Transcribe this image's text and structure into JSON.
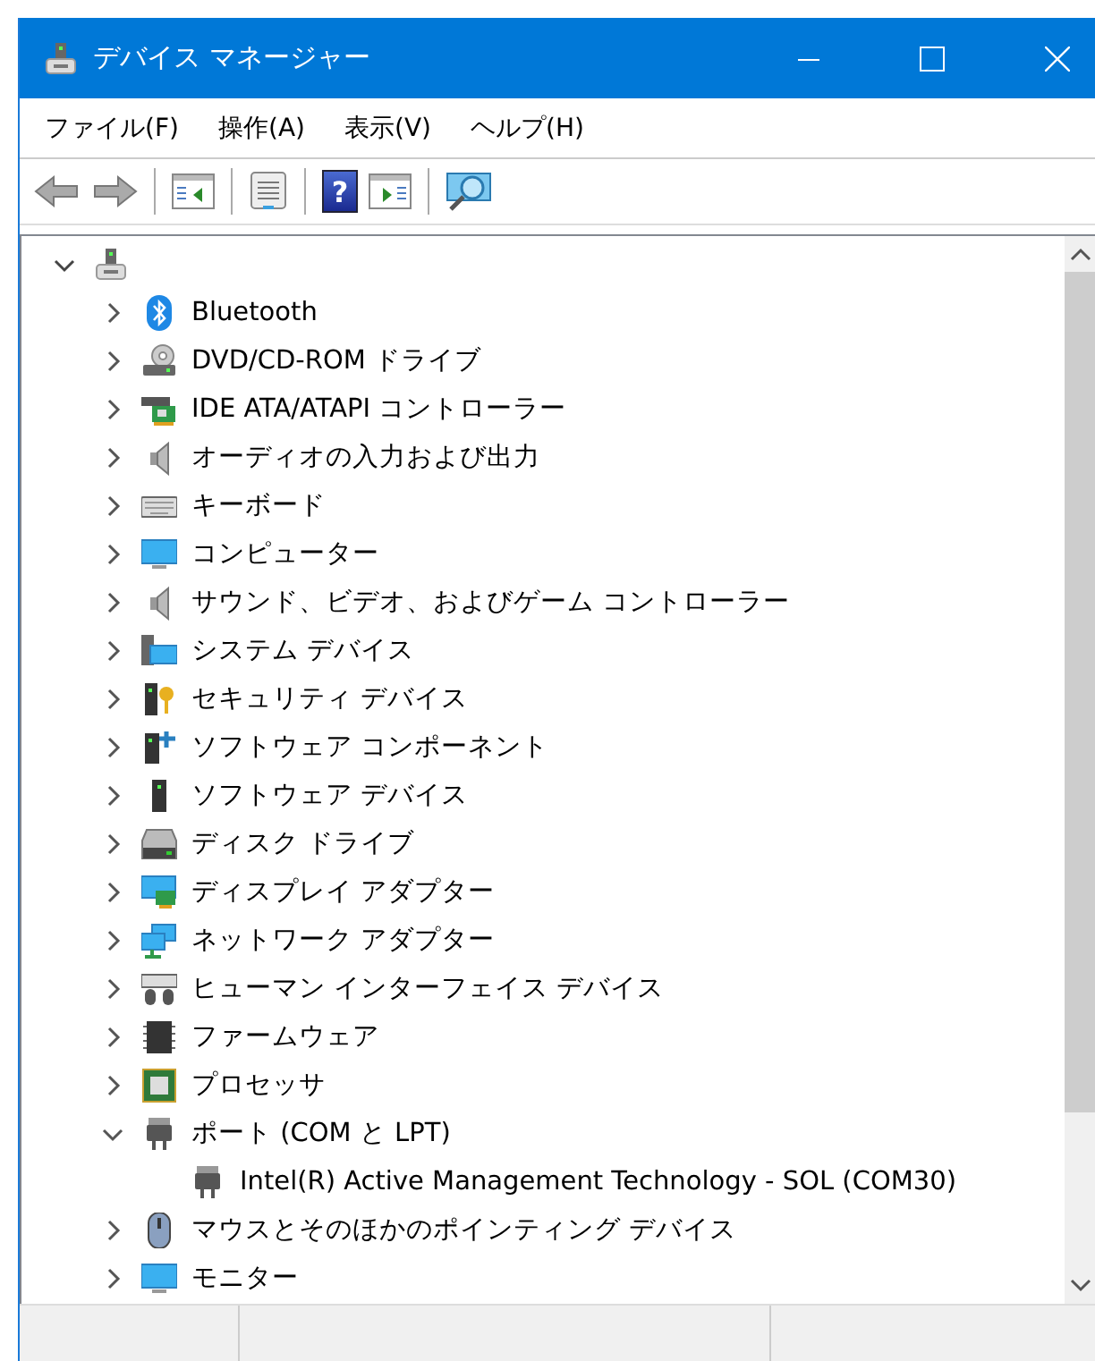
{
  "window": {
    "title": "デバイス マネージャー"
  },
  "menu": [
    "ファイル(F)",
    "操作(A)",
    "表示(V)",
    "ヘルプ(H)"
  ],
  "toolbar": {
    "help_glyph": "?"
  },
  "tree": {
    "expanded": true,
    "children": [
      {
        "label": "Bluetooth",
        "expanded": false
      },
      {
        "label": "DVD/CD-ROM ドライブ",
        "expanded": false
      },
      {
        "label": "IDE ATA/ATAPI コントローラー",
        "expanded": false
      },
      {
        "label": "オーディオの入力および出力",
        "expanded": false
      },
      {
        "label": "キーボード",
        "expanded": false
      },
      {
        "label": "コンピューター",
        "expanded": false
      },
      {
        "label": "サウンド、ビデオ、およびゲーム コントローラー",
        "expanded": false
      },
      {
        "label": "システム デバイス",
        "expanded": false
      },
      {
        "label": "セキュリティ デバイス",
        "expanded": false
      },
      {
        "label": "ソフトウェア コンポーネント",
        "expanded": false
      },
      {
        "label": "ソフトウェア デバイス",
        "expanded": false
      },
      {
        "label": "ディスク ドライブ",
        "expanded": false
      },
      {
        "label": "ディスプレイ アダプター",
        "expanded": false
      },
      {
        "label": "ネットワーク アダプター",
        "expanded": false
      },
      {
        "label": "ヒューマン インターフェイス デバイス",
        "expanded": false
      },
      {
        "label": "ファームウェア",
        "expanded": false
      },
      {
        "label": "プロセッサ",
        "expanded": false
      },
      {
        "label": "ポート (COM と LPT)",
        "expanded": true,
        "children": [
          {
            "label": "Intel(R) Active Management Technology - SOL (COM30)"
          }
        ]
      },
      {
        "label": "マウスとそのほかのポインティング デバイス",
        "expanded": false
      },
      {
        "label": "モニター",
        "expanded": false
      }
    ]
  }
}
